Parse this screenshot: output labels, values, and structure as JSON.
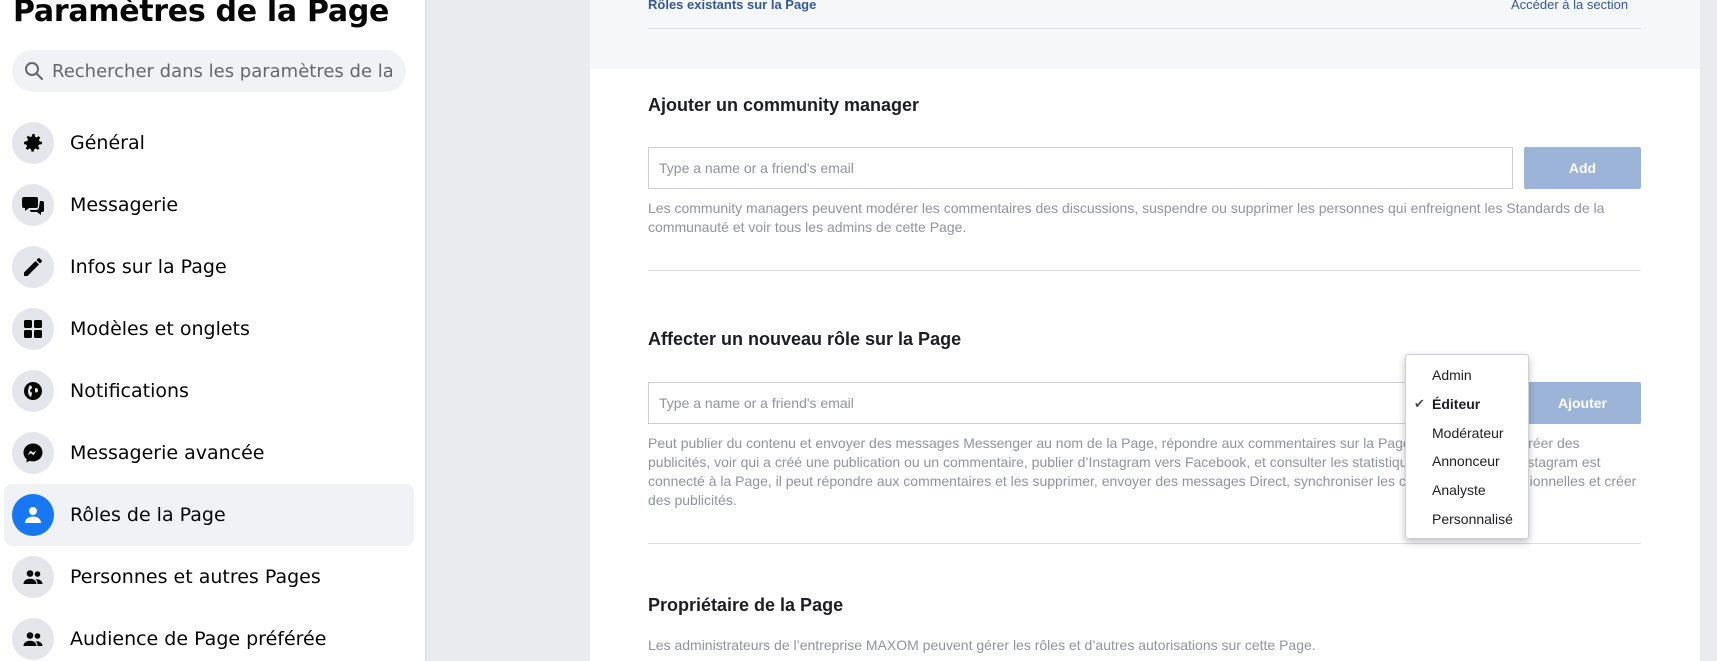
{
  "sidebar": {
    "title": "Paramètres de la Page",
    "search_placeholder": "Rechercher dans les paramètres de la Page",
    "items": [
      {
        "label": "Général",
        "icon": "gear-icon"
      },
      {
        "label": "Messagerie",
        "icon": "chat-bubbles-icon"
      },
      {
        "label": "Infos sur la Page",
        "icon": "pencil-icon"
      },
      {
        "label": "Modèles et onglets",
        "icon": "grid-icon"
      },
      {
        "label": "Notifications",
        "icon": "globe-icon"
      },
      {
        "label": "Messagerie avancée",
        "icon": "messenger-icon"
      },
      {
        "label": "Rôles de la Page",
        "icon": "person-icon",
        "active": true
      },
      {
        "label": "Personnes et autres Pages",
        "icon": "people-icon"
      },
      {
        "label": "Audience de Page préférée",
        "icon": "people-icon"
      }
    ]
  },
  "top": {
    "existing_roles": "Rôles existants sur la Page",
    "go_to_section": "Accéder à la section"
  },
  "community": {
    "title": "Ajouter un community manager",
    "placeholder": "Type a name or a friend's email",
    "button": "Add",
    "description": "Les community managers peuvent modérer les commentaires des discussions, suspendre ou supprimer les personnes qui enfreignent les Standards de la communauté et voir tous les admins de cette Page."
  },
  "role": {
    "title": "Affecter un nouveau rôle sur la Page",
    "placeholder": "Type a name or a friend's email",
    "button": "Ajouter",
    "description": "Peut publier du contenu et envoyer des messages Messenger au nom de la Page, répondre aux commentaires sur la Page et les supprimer, créer des publicités, voir qui a créé une publication ou un commentaire, publier d’Instagram vers Facebook, et consulter les statistiques. Si un compte Instagram est connecté à la Page, il peut répondre aux commentaires et les supprimer, envoyer des messages Direct, synchroniser les coordonnées professionnelles et créer des publicités."
  },
  "dropdown": {
    "options": [
      "Admin",
      "Éditeur",
      "Modérateur",
      "Annonceur",
      "Analyste",
      "Personnalisé"
    ],
    "selected": "Éditeur",
    "check": "✔"
  },
  "owner": {
    "title": "Propriétaire de la Page",
    "description": "Les administrateurs de l’entreprise MAXOM peuvent gérer les rôles et d’autres autorisations sur cette Page."
  },
  "colors": {
    "accent": "#1877f2",
    "link": "#365899",
    "button_disabled": "#9cb4d8",
    "muted_text": "#90949c"
  }
}
